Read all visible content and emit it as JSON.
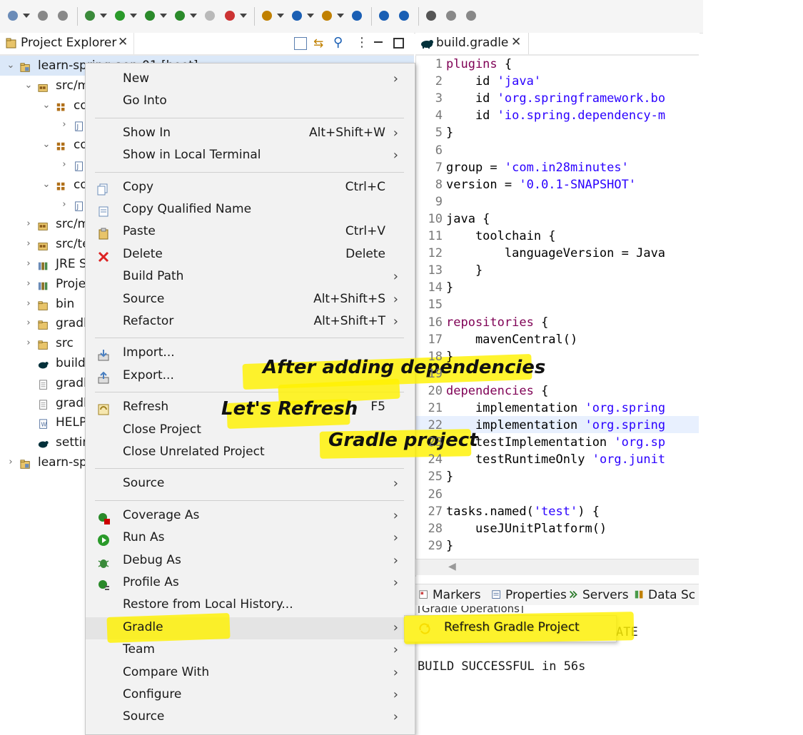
{
  "toolbar": {
    "icons": [
      "new-icon",
      "save-icon",
      "save-all-icon",
      "debug-icon",
      "run-icon",
      "coverage-icon",
      "profile-icon",
      "stop-icon",
      "external-tools-icon",
      "new-wizard-icon",
      "new-class-icon",
      "open-type-icon",
      "search-icon",
      "globe-icon",
      "open-task-icon",
      "console-icon",
      "pin-icon",
      "step-icon"
    ]
  },
  "explorer": {
    "tab_title": "Project Explorer",
    "tree": [
      {
        "label": "learn-spring-aop-01 [boot]",
        "partial": "learn-spring-aop-01 [boot]",
        "indent": 0,
        "expanded": true,
        "icon": "project-icon"
      },
      {
        "label": "src/m",
        "indent": 1,
        "expanded": true,
        "icon": "source-folder-icon"
      },
      {
        "label": "co",
        "indent": 2,
        "expanded": true,
        "icon": "package-icon"
      },
      {
        "label": "",
        "indent": 3,
        "expanded": false,
        "icon": "java-file-icon"
      },
      {
        "label": "co",
        "indent": 2,
        "expanded": true,
        "icon": "package-icon"
      },
      {
        "label": "",
        "indent": 3,
        "expanded": false,
        "icon": "java-file-icon"
      },
      {
        "label": "co",
        "indent": 2,
        "expanded": true,
        "icon": "package-icon"
      },
      {
        "label": "",
        "indent": 3,
        "expanded": false,
        "icon": "java-file-icon"
      },
      {
        "label": "src/m",
        "indent": 1,
        "expanded": false,
        "icon": "source-folder-icon"
      },
      {
        "label": "src/te",
        "indent": 1,
        "expanded": false,
        "icon": "source-folder-icon"
      },
      {
        "label": "JRE S",
        "indent": 1,
        "expanded": false,
        "icon": "library-icon"
      },
      {
        "label": "Proje",
        "indent": 1,
        "expanded": false,
        "icon": "library-icon"
      },
      {
        "label": "bin",
        "indent": 1,
        "expanded": false,
        "icon": "folder-icon"
      },
      {
        "label": "gradl",
        "indent": 1,
        "expanded": false,
        "icon": "folder-icon"
      },
      {
        "label": "src",
        "indent": 1,
        "expanded": false,
        "icon": "folder-icon"
      },
      {
        "label": "build",
        "indent": 1,
        "expanded": null,
        "icon": "gradle-file-icon"
      },
      {
        "label": "gradl",
        "indent": 1,
        "expanded": null,
        "icon": "file-icon"
      },
      {
        "label": "gradl",
        "indent": 1,
        "expanded": null,
        "icon": "file-icon"
      },
      {
        "label": "HELP",
        "indent": 1,
        "expanded": null,
        "icon": "web-file-icon"
      },
      {
        "label": "settin",
        "indent": 1,
        "expanded": null,
        "icon": "gradle-file-icon"
      },
      {
        "label": "learn-sp",
        "indent": 0,
        "expanded": false,
        "icon": "project-icon"
      }
    ]
  },
  "editor": {
    "tab_title": "build.gradle",
    "lines": [
      {
        "n": "1",
        "code": [
          [
            "plugins",
            "kw"
          ],
          [
            " {",
            ""
          ]
        ]
      },
      {
        "n": "2",
        "code": [
          [
            "    id ",
            ""
          ],
          [
            "'java'",
            "str"
          ]
        ]
      },
      {
        "n": "3",
        "code": [
          [
            "    id ",
            ""
          ],
          [
            "'org.springframework.bo",
            "str"
          ]
        ]
      },
      {
        "n": "4",
        "code": [
          [
            "    id ",
            ""
          ],
          [
            "'io.spring.dependency-m",
            "str"
          ]
        ]
      },
      {
        "n": "5",
        "code": [
          [
            "}",
            ""
          ]
        ]
      },
      {
        "n": "6",
        "code": []
      },
      {
        "n": "7",
        "code": [
          [
            "group = ",
            ""
          ],
          [
            "'com.in28minutes'",
            "str"
          ]
        ]
      },
      {
        "n": "8",
        "code": [
          [
            "version = ",
            ""
          ],
          [
            "'0.0.1-SNAPSHOT'",
            "str"
          ]
        ]
      },
      {
        "n": "9",
        "code": []
      },
      {
        "n": "10",
        "code": [
          [
            "java {",
            ""
          ]
        ]
      },
      {
        "n": "11",
        "code": [
          [
            "    toolchain {",
            ""
          ]
        ]
      },
      {
        "n": "12",
        "code": [
          [
            "        languageVersion = Java",
            ""
          ]
        ]
      },
      {
        "n": "13",
        "code": [
          [
            "    }",
            ""
          ]
        ]
      },
      {
        "n": "14",
        "code": [
          [
            "}",
            ""
          ]
        ]
      },
      {
        "n": "15",
        "code": []
      },
      {
        "n": "16",
        "code": [
          [
            "repositories",
            "kw"
          ],
          [
            " {",
            ""
          ]
        ]
      },
      {
        "n": "17",
        "code": [
          [
            "    mavenCentral()",
            ""
          ]
        ]
      },
      {
        "n": "18",
        "code": [
          [
            "}",
            ""
          ]
        ]
      },
      {
        "n": "19",
        "code": []
      },
      {
        "n": "20",
        "code": [
          [
            "dependencies",
            "kw"
          ],
          [
            " {",
            ""
          ]
        ]
      },
      {
        "n": "21",
        "code": [
          [
            "    implementation ",
            ""
          ],
          [
            "'org.spring",
            "str"
          ]
        ]
      },
      {
        "n": "22",
        "code": [
          [
            "    implementation ",
            ""
          ],
          [
            "'org.spring",
            "str"
          ]
        ]
      },
      {
        "n": "23",
        "code": [
          [
            "    testImplementation ",
            ""
          ],
          [
            "'org.sp",
            "str"
          ]
        ]
      },
      {
        "n": "24",
        "code": [
          [
            "    testRuntimeOnly ",
            ""
          ],
          [
            "'org.junit",
            "str"
          ]
        ]
      },
      {
        "n": "25",
        "code": [
          [
            "}",
            ""
          ]
        ]
      },
      {
        "n": "26",
        "code": []
      },
      {
        "n": "27",
        "code": [
          [
            "tasks.named(",
            ""
          ],
          [
            "'test'",
            "str"
          ],
          [
            ") {",
            ""
          ]
        ]
      },
      {
        "n": "28",
        "code": [
          [
            "    useJUnitPlatform()",
            ""
          ]
        ]
      },
      {
        "n": "29",
        "code": [
          [
            "}",
            ""
          ]
        ]
      }
    ]
  },
  "bottom": {
    "tabs": [
      {
        "label": "Markers",
        "icon": "markers-icon"
      },
      {
        "label": "Properties",
        "icon": "properties-icon"
      },
      {
        "label": "Servers",
        "icon": "servers-icon"
      },
      {
        "label": "Data Sc",
        "icon": "data-source-icon"
      }
    ],
    "console_header": "[Gradle Operations]",
    "console_lines": [
      "ATE",
      "",
      "BUILD SUCCESSFUL in 56s"
    ]
  },
  "context_menu": {
    "items": [
      {
        "label": "New",
        "shortcut": "",
        "submenu": true,
        "icon": ""
      },
      {
        "label": "Go Into",
        "shortcut": "",
        "submenu": false,
        "icon": ""
      },
      {
        "sep": true
      },
      {
        "label": "Show In",
        "shortcut": "Alt+Shift+W",
        "submenu": true,
        "icon": ""
      },
      {
        "label": "Show in Local Terminal",
        "shortcut": "",
        "submenu": true,
        "icon": ""
      },
      {
        "sep": true
      },
      {
        "label": "Copy",
        "shortcut": "Ctrl+C",
        "submenu": false,
        "icon": "copy-icon"
      },
      {
        "label": "Copy Qualified Name",
        "shortcut": "",
        "submenu": false,
        "icon": "copy-qualified-icon"
      },
      {
        "label": "Paste",
        "shortcut": "Ctrl+V",
        "submenu": false,
        "icon": "paste-icon"
      },
      {
        "label": "Delete",
        "shortcut": "Delete",
        "submenu": false,
        "icon": "delete-icon"
      },
      {
        "label": "Build Path",
        "shortcut": "",
        "submenu": true,
        "icon": ""
      },
      {
        "label": "Source",
        "shortcut": "Alt+Shift+S",
        "submenu": true,
        "icon": ""
      },
      {
        "label": "Refactor",
        "shortcut": "Alt+Shift+T",
        "submenu": true,
        "icon": ""
      },
      {
        "sep": true
      },
      {
        "label": "Import...",
        "shortcut": "",
        "submenu": false,
        "icon": "import-icon"
      },
      {
        "label": "Export...",
        "shortcut": "",
        "submenu": false,
        "icon": "export-icon"
      },
      {
        "sep": true
      },
      {
        "label": "Refresh",
        "shortcut": "F5",
        "submenu": false,
        "icon": "refresh-icon"
      },
      {
        "label": "Close Project",
        "shortcut": "",
        "submenu": false,
        "icon": ""
      },
      {
        "label": "Close Unrelated Project",
        "shortcut": "",
        "submenu": false,
        "icon": ""
      },
      {
        "sep": true
      },
      {
        "label": "Source",
        "shortcut": "",
        "submenu": true,
        "icon": ""
      },
      {
        "sep": true
      },
      {
        "label": "Coverage As",
        "shortcut": "",
        "submenu": true,
        "icon": "coverage-icon"
      },
      {
        "label": "Run As",
        "shortcut": "",
        "submenu": true,
        "icon": "run-icon"
      },
      {
        "label": "Debug As",
        "shortcut": "",
        "submenu": true,
        "icon": "debug-icon"
      },
      {
        "label": "Profile As",
        "shortcut": "",
        "submenu": true,
        "icon": "profile-icon"
      },
      {
        "label": "Restore from Local History...",
        "shortcut": "",
        "submenu": false,
        "icon": ""
      },
      {
        "label": "Gradle",
        "shortcut": "",
        "submenu": true,
        "icon": "",
        "active": true
      },
      {
        "label": "Team",
        "shortcut": "",
        "submenu": true,
        "icon": ""
      },
      {
        "label": "Compare With",
        "shortcut": "",
        "submenu": true,
        "icon": ""
      },
      {
        "label": "Configure",
        "shortcut": "",
        "submenu": true,
        "icon": ""
      },
      {
        "label": "Source",
        "shortcut": "",
        "submenu": true,
        "icon": ""
      }
    ]
  },
  "submenu": {
    "label": "Refresh Gradle Project",
    "icon": "refresh-gradle-icon"
  },
  "annotations": {
    "line1": "After adding dependencies",
    "line2": "Let's Refresh",
    "line3": "Gradle project"
  },
  "colors": {
    "keyword": "#7f0055",
    "string": "#2a00ff",
    "highlight": "#fff200",
    "menu_bg": "#f2f2f2"
  }
}
